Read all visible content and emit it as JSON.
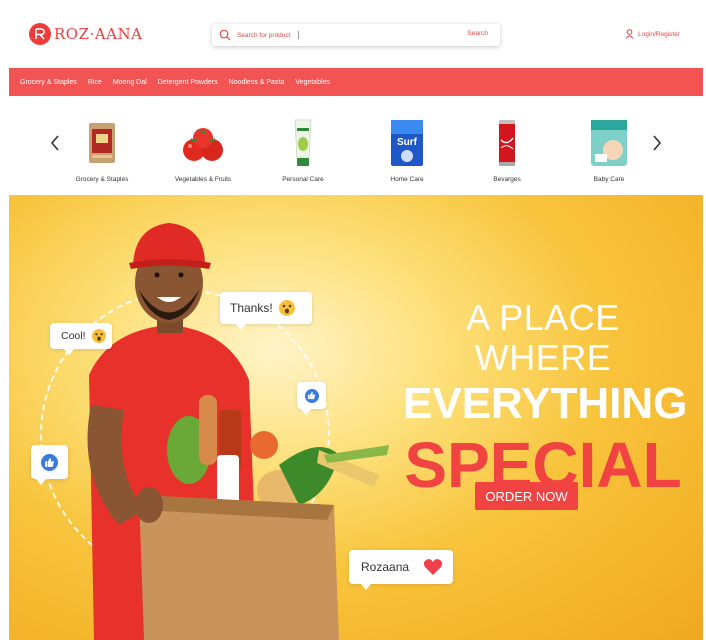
{
  "header": {
    "logo_text": "ROZ·AANA",
    "search_placeholder": "Search for product",
    "search_button": "Search",
    "login_label": "Login/Register"
  },
  "nav": {
    "items": [
      "Grocery & Staples",
      "Rice",
      "Moong Dal",
      "Detergent Powders",
      "Noodless & Pasta",
      "Vegetables"
    ]
  },
  "categories": {
    "items": [
      {
        "label": "Grocery & Staples",
        "icon": "grocery-pack-icon"
      },
      {
        "label": "Vegetables & Fruits",
        "icon": "tomatoes-icon"
      },
      {
        "label": "Personal Care",
        "icon": "face-wash-tube-icon"
      },
      {
        "label": "Home Care",
        "icon": "detergent-box-icon"
      },
      {
        "label": "Bevarges",
        "icon": "cola-can-icon"
      },
      {
        "label": "Baby Care",
        "icon": "diaper-pack-icon"
      }
    ]
  },
  "hero": {
    "bubble_thanks": "Thanks!",
    "bubble_cool": "Cool!",
    "bubble_rozaana": "Rozaana",
    "headline_line1": "A PLACE WHERE",
    "headline_line2": "EVERYTHING",
    "headline_line3": "SPECIAL",
    "cta_label": "ORDER NOW"
  },
  "colors": {
    "brand_red": "#f14341",
    "nav_red": "#f15452",
    "hero_yellow": "#f8c43c"
  }
}
